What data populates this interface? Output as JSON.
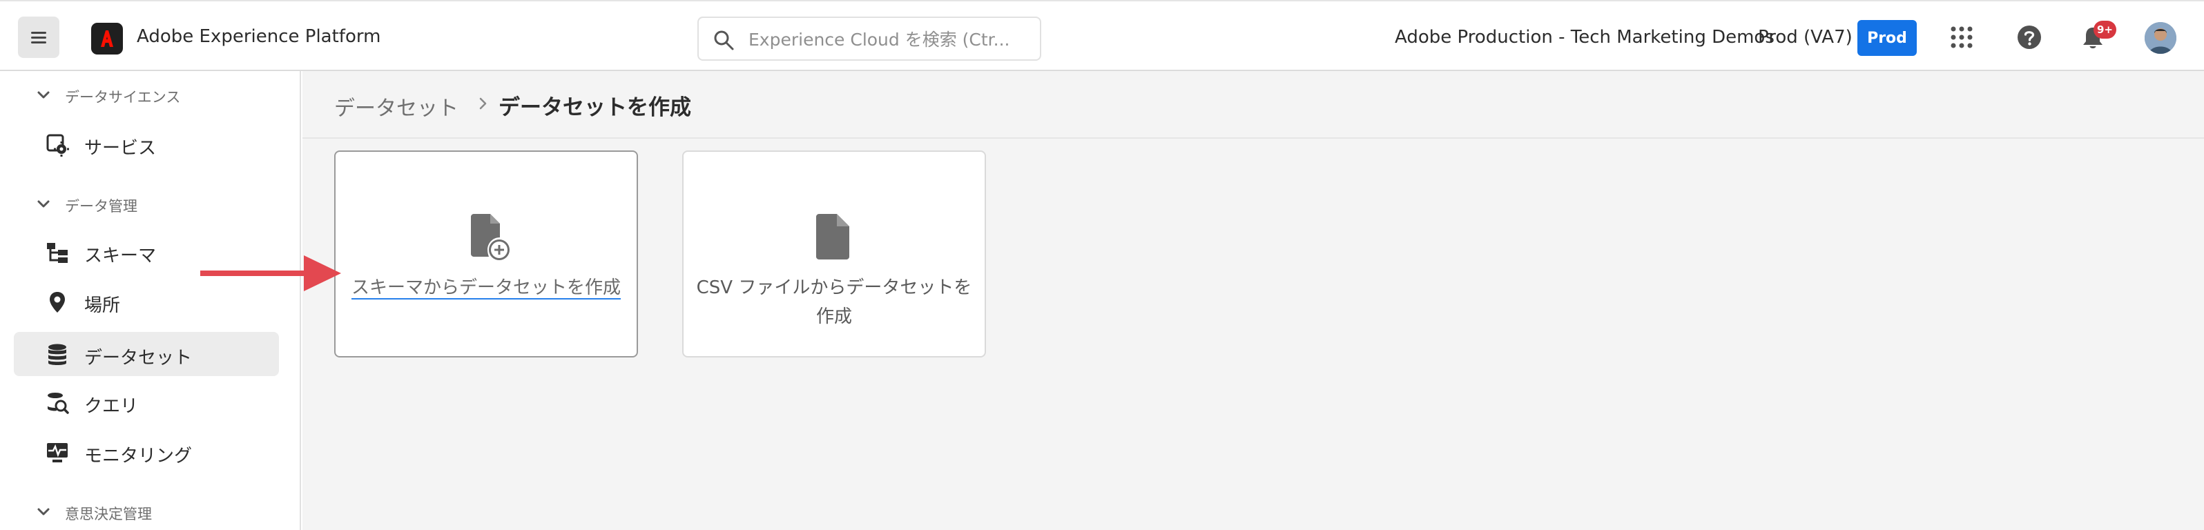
{
  "header": {
    "app_title": "Adobe Experience Platform",
    "search_placeholder": "Experience Cloud を検索 (Ctr...",
    "org_name": "Adobe Production - Tech Marketing Demos",
    "sandbox_name": "Prod (VA7)",
    "sandbox_badge": "Prod",
    "notification_count": "9+",
    "icons": [
      "menu-icon",
      "adobe-logo-icon",
      "search-icon",
      "apps-grid-icon",
      "help-icon",
      "bell-icon"
    ]
  },
  "sidebar": {
    "sections": [
      {
        "label": "データサイエンス",
        "items": [
          {
            "label": "サービス",
            "icon": "service-gear-icon"
          }
        ]
      },
      {
        "label": "データ管理",
        "items": [
          {
            "label": "スキーマ",
            "icon": "schema-icon"
          },
          {
            "label": "場所",
            "icon": "location-pin-icon"
          },
          {
            "label": "データセット",
            "icon": "database-icon",
            "active": true
          },
          {
            "label": "クエリ",
            "icon": "query-icon"
          },
          {
            "label": "モニタリング",
            "icon": "monitoring-icon"
          }
        ]
      },
      {
        "label": "意思決定管理",
        "items": []
      }
    ]
  },
  "breadcrumb": {
    "parent": "データセット",
    "current": "データセットを作成"
  },
  "cards": [
    {
      "label": "スキーマからデータセットを作成",
      "icon": "file-add-icon"
    },
    {
      "label_line1": "CSV ファイルからデータセットを",
      "label_line2": "作成",
      "icon": "file-icon"
    }
  ],
  "colors": {
    "accent": "#1473e6",
    "annotation_arrow": "#e34850",
    "notification": "#d7373f"
  }
}
